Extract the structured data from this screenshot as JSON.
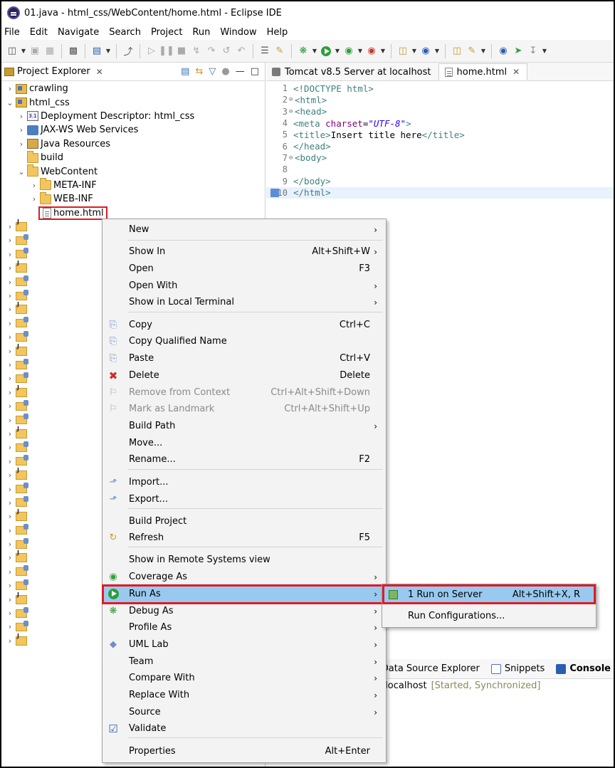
{
  "window": {
    "title": "01.java - html_css/WebContent/home.html - Eclipse IDE"
  },
  "menubar": [
    "File",
    "Edit",
    "Navigate",
    "Search",
    "Project",
    "Run",
    "Window",
    "Help"
  ],
  "project_explorer": {
    "tab_label": "Project Explorer",
    "items": [
      {
        "label": "crawling",
        "icon": "project-icon"
      },
      {
        "label": "html_css",
        "icon": "project-icon"
      },
      {
        "label": "Deployment Descriptor: html_css",
        "icon": "deployment-descriptor-icon"
      },
      {
        "label": "JAX-WS Web Services",
        "icon": "web-services-icon"
      },
      {
        "label": "Java Resources",
        "icon": "java-resources-icon"
      },
      {
        "label": "build",
        "icon": "folder-icon"
      },
      {
        "label": "WebContent",
        "icon": "folder-icon"
      },
      {
        "label": "META-INF",
        "icon": "folder-icon"
      },
      {
        "label": "WEB-INF",
        "icon": "folder-icon"
      },
      {
        "label": "home.html",
        "icon": "html-file-icon"
      }
    ]
  },
  "editor": {
    "tabs": [
      {
        "label": "Tomcat v8.5 Server at localhost"
      },
      {
        "label": "home.html"
      }
    ],
    "lines": [
      {
        "num": "1",
        "text": "<!DOCTYPE html>"
      },
      {
        "num": "2",
        "text": "<html>"
      },
      {
        "num": "3",
        "text": "<head>"
      },
      {
        "num": "4",
        "pre": "<meta ",
        "attr": "charset",
        "eq": "=",
        "val": "\"UTF-8\"",
        "post": ">"
      },
      {
        "num": "5",
        "pre": "<title>",
        "body": "Insert title here",
        "post": "</title>"
      },
      {
        "num": "6",
        "text": "</head>"
      },
      {
        "num": "7",
        "text": "<body>"
      },
      {
        "num": "8",
        "text": ""
      },
      {
        "num": "9",
        "text": "</body>"
      },
      {
        "num": "10",
        "text": "</html>"
      }
    ]
  },
  "bottom_panel": {
    "tabs": [
      "Data Source Explorer",
      "Snippets",
      "Console"
    ],
    "server_text": "at localhost",
    "server_status": "[Started, Synchronized]"
  },
  "context_menu": {
    "items": [
      {
        "label": "New",
        "shortcut": "",
        "submenu": true
      },
      {
        "label": "Show In",
        "shortcut": "Alt+Shift+W",
        "submenu": true
      },
      {
        "label": "Open",
        "shortcut": "F3"
      },
      {
        "label": "Open With",
        "shortcut": "",
        "submenu": true
      },
      {
        "label": "Show in Local Terminal",
        "shortcut": "",
        "submenu": true
      },
      {
        "label": "Copy",
        "shortcut": "Ctrl+C"
      },
      {
        "label": "Copy Qualified Name",
        "shortcut": ""
      },
      {
        "label": "Paste",
        "shortcut": "Ctrl+V"
      },
      {
        "label": "Delete",
        "shortcut": "Delete"
      },
      {
        "label": "Remove from Context",
        "shortcut": "Ctrl+Alt+Shift+Down",
        "disabled": true
      },
      {
        "label": "Mark as Landmark",
        "shortcut": "Ctrl+Alt+Shift+Up",
        "disabled": true
      },
      {
        "label": "Build Path",
        "shortcut": "",
        "submenu": true
      },
      {
        "label": "Move...",
        "shortcut": ""
      },
      {
        "label": "Rename...",
        "shortcut": "F2"
      },
      {
        "label": "Import...",
        "shortcut": ""
      },
      {
        "label": "Export...",
        "shortcut": ""
      },
      {
        "label": "Build Project",
        "shortcut": ""
      },
      {
        "label": "Refresh",
        "shortcut": "F5"
      },
      {
        "label": "Show in Remote Systems view",
        "shortcut": ""
      },
      {
        "label": "Coverage As",
        "shortcut": "",
        "submenu": true
      },
      {
        "label": "Run As",
        "shortcut": "",
        "submenu": true,
        "selected": true
      },
      {
        "label": "Debug As",
        "shortcut": "",
        "submenu": true
      },
      {
        "label": "Profile As",
        "shortcut": "",
        "submenu": true
      },
      {
        "label": "UML Lab",
        "shortcut": "",
        "submenu": true
      },
      {
        "label": "Team",
        "shortcut": "",
        "submenu": true
      },
      {
        "label": "Compare With",
        "shortcut": "",
        "submenu": true
      },
      {
        "label": "Replace With",
        "shortcut": "",
        "submenu": true
      },
      {
        "label": "Source",
        "shortcut": "",
        "submenu": true
      },
      {
        "label": "Validate",
        "shortcut": ""
      },
      {
        "label": "Properties",
        "shortcut": "Alt+Enter"
      }
    ]
  },
  "run_as_submenu": {
    "items": [
      {
        "label": "1 Run on Server",
        "shortcut": "Alt+Shift+X, R"
      },
      {
        "label": "Run Configurations...",
        "shortcut": ""
      }
    ]
  },
  "colors": {
    "highlight_red": "#e01b24",
    "menu_selection": "#99c9ef",
    "run_green": "#2e9e3b"
  }
}
